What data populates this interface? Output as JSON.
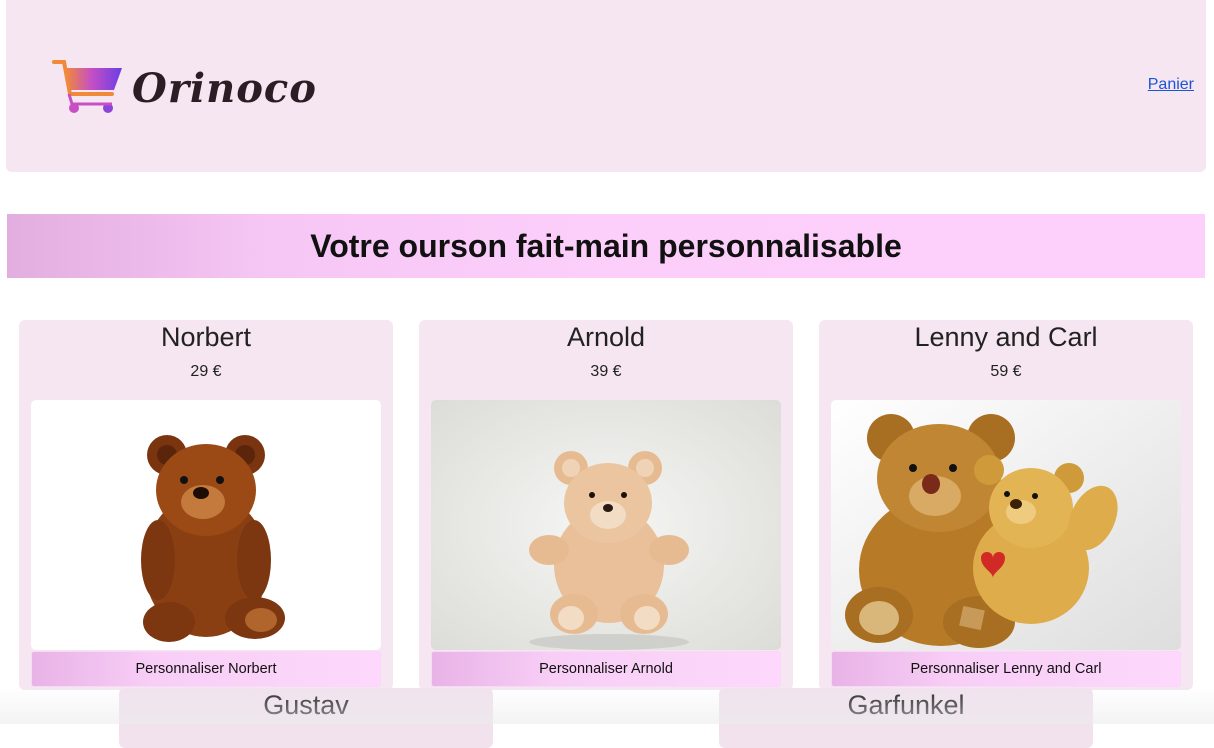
{
  "header": {
    "logo_text": "Orinoco",
    "cart_link": "Panier"
  },
  "banner": {
    "title": "Votre ourson fait-main personnalisable"
  },
  "products": [
    {
      "name": "Norbert",
      "price": "29 €",
      "button": "Personnaliser Norbert"
    },
    {
      "name": "Arnold",
      "price": "39 €",
      "button": "Personnaliser Arnold"
    },
    {
      "name": "Lenny and Carl",
      "price": "59 €",
      "button": "Personnaliser Lenny and Carl"
    }
  ],
  "more_products": [
    {
      "name": "Gustav"
    },
    {
      "name": "Garfunkel"
    }
  ],
  "colors": {
    "header_bg": "#f5e6f1",
    "banner_gradient_start": "#e2aee0",
    "banner_gradient_end": "#fcd0fb",
    "link": "#1a55d6"
  }
}
